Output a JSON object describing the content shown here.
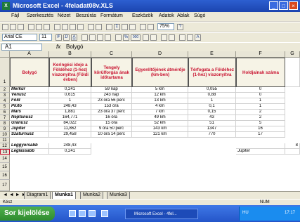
{
  "window": {
    "title": "Microsoft Excel - 4feladat08v.XLS"
  },
  "menu": [
    "Fájl",
    "Szerkesztés",
    "Nézet",
    "Beszúrás",
    "Formátum",
    "Eszközök",
    "Adatok",
    "Ablak",
    "Súgó"
  ],
  "toolbar": {
    "zoom": "75%",
    "font_name": "Arial CE",
    "font_size": "11",
    "bold": "F",
    "italic": "D",
    "underline": "A",
    "percent": "%",
    "thousands": "000"
  },
  "formula_bar": {
    "cell_ref": "A1",
    "fx": "fx",
    "value": "Bolygó"
  },
  "columns": [
    "A",
    "B",
    "C",
    "D",
    "E",
    "F",
    "G"
  ],
  "headers": {
    "a": "Bolygó",
    "b": "Keringési ideje a Földéhez (1-hez) viszonyítva (Földi évben)",
    "c": "Tengely körülforgás ának időtartama",
    "d": "Egyenlítőjének átmérője (km-ben)",
    "e": "Térfogata a Földéhez (1-hez) viszonyítva",
    "f": "Holdjainak száma"
  },
  "rows": [
    {
      "num": "2",
      "name": "Merkúr",
      "b": "0,241",
      "c": "59 nap",
      "d": "5 km",
      "e": "0,055",
      "f": "0"
    },
    {
      "num": "3",
      "name": "Vénusz",
      "b": "0,615",
      "c": "243 nap",
      "d": "12 km",
      "e": "0,88",
      "f": "0"
    },
    {
      "num": "4",
      "name": "Föld",
      "b": "1",
      "c": "23 óra 56 perc",
      "d": "13 km",
      "e": "1",
      "f": "1"
    },
    {
      "num": "5",
      "name": "Plútó",
      "b": "248,43",
      "c": "153 óra",
      "d": "4 km",
      "e": "0,1",
      "f": "1"
    },
    {
      "num": "6",
      "name": "Mars",
      "b": "1,881",
      "c": "23 óra 37 perc",
      "d": "7 km",
      "e": "0,15",
      "f": "2"
    },
    {
      "num": "7",
      "name": "Neptunusz",
      "b": "164,771",
      "c": "16 óra",
      "d": "49 km",
      "e": "43",
      "f": "2"
    },
    {
      "num": "8",
      "name": "Uránusz",
      "b": "84,022",
      "c": "15 óra",
      "d": "52 km",
      "e": "51",
      "f": "5"
    },
    {
      "num": "9",
      "name": "Jupiter",
      "b": "11,862",
      "c": "9 óra 50 perc",
      "d": "143 km",
      "e": "1347",
      "f": "16"
    },
    {
      "num": "10",
      "name": "Szaturnusz",
      "b": "29,458",
      "c": "10 óra 14 perc",
      "d": "121 km",
      "e": "770",
      "f": "17"
    }
  ],
  "summary": [
    {
      "num": "12",
      "label": "Leggyorsabb",
      "b": "248,43",
      "f": "",
      "g": "8"
    },
    {
      "num": "13",
      "label": "Leglassabb",
      "b": "0,241",
      "f": "Jupiter",
      "g": ""
    }
  ],
  "empty_rows": [
    "11",
    "14",
    "15",
    "16",
    "17"
  ],
  "sheets": {
    "nav": "◄ ◄ ► ►",
    "tabs": [
      "Diagram1",
      "Munka1",
      "Munka2",
      "Munka3"
    ],
    "active_index": 1
  },
  "status": {
    "left": "Kész",
    "right": "NUM"
  },
  "taskbar": {
    "start": "Sor kijelölése",
    "task": "Microsoft Excel - 4fel...",
    "lang": "HU",
    "clock": "17:17"
  }
}
